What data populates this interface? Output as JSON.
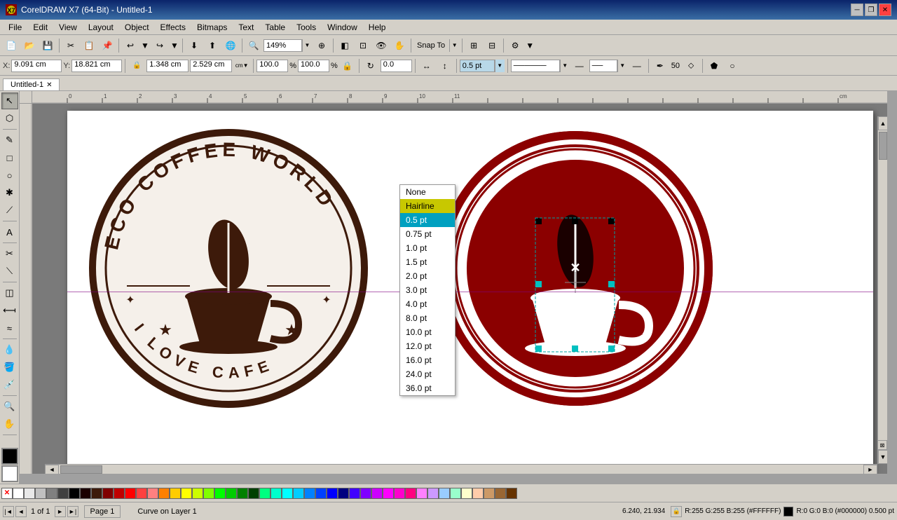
{
  "titlebar": {
    "title": "CorelDRAW X7 (64-Bit) - Untitled-1",
    "minimize": "─",
    "maximize": "□",
    "close": "✕",
    "restore": "❐"
  },
  "menubar": {
    "items": [
      "File",
      "Edit",
      "View",
      "Layout",
      "Object",
      "Effects",
      "Bitmaps",
      "Text",
      "Table",
      "Tools",
      "Window",
      "Help"
    ]
  },
  "toolbar": {
    "zoom_level": "149%",
    "snap_to": "Snap To"
  },
  "properties": {
    "x_label": "X:",
    "x_value": "9.091 cm",
    "y_label": "Y:",
    "y_value": "18.821 cm",
    "w_label": "",
    "w_value": "1.348 cm",
    "h_value": "2.529 cm",
    "scale1": "100.0",
    "scale2": "100.0",
    "angle": "0.0",
    "outline_size": "0.5 pt",
    "line_style": "──────",
    "arrow_end": "──",
    "percent_label": "50"
  },
  "document_tab": {
    "name": "Untitled-1",
    "close_btn": "✕"
  },
  "dropdown": {
    "items": [
      {
        "label": "None",
        "state": "normal"
      },
      {
        "label": "Hairline",
        "state": "highlighted"
      },
      {
        "label": "0.5 pt",
        "state": "selected"
      },
      {
        "label": "0.75 pt",
        "state": "normal"
      },
      {
        "label": "1.0 pt",
        "state": "normal"
      },
      {
        "label": "1.5 pt",
        "state": "normal"
      },
      {
        "label": "2.0 pt",
        "state": "normal"
      },
      {
        "label": "3.0 pt",
        "state": "normal"
      },
      {
        "label": "4.0 pt",
        "state": "normal"
      },
      {
        "label": "8.0 pt",
        "state": "normal"
      },
      {
        "label": "10.0 pt",
        "state": "normal"
      },
      {
        "label": "12.0 pt",
        "state": "normal"
      },
      {
        "label": "16.0 pt",
        "state": "normal"
      },
      {
        "label": "24.0 pt",
        "state": "normal"
      },
      {
        "label": "36.0 pt",
        "state": "normal"
      }
    ]
  },
  "statusbar": {
    "coords": "6.240, 21.934",
    "page_info": "1 of 1",
    "page_name": "Page 1",
    "status_text": "Curve on Layer 1",
    "color_info": "R:255 G:255 B:255 (#FFFFFF)",
    "outline_info": "R:0 G:0 B:0 (#000000) 0.500 pt"
  },
  "palette": {
    "colors": [
      "#FFFFFF",
      "#000000",
      "#808080",
      "#C0C0C0",
      "#800000",
      "#FF0000",
      "#FF8000",
      "#FFFF00",
      "#808000",
      "#00FF00",
      "#008000",
      "#00FFFF",
      "#008080",
      "#0000FF",
      "#000080",
      "#FF00FF",
      "#800080",
      "#FF8080",
      "#FF80FF",
      "#8080FF",
      "#80FFFF",
      "#80FF80",
      "#FFFF80",
      "#FF8040",
      "#804000",
      "#004080",
      "#0080FF",
      "#00FF80",
      "#FF0080",
      "#8000FF",
      "#FF4040",
      "#40FF40",
      "#4040FF",
      "#FFCC00",
      "#CC6600",
      "#996633",
      "#663300",
      "#CCCC00",
      "#CC9900",
      "#999900",
      "#669900",
      "#336600",
      "#003300",
      "#006633",
      "#009966",
      "#00CC99",
      "#00FFCC",
      "#33FFFF",
      "#3399FF",
      "#3366FF",
      "#3333FF",
      "#6633FF",
      "#9933FF",
      "#CC33FF",
      "#FF33CC",
      "#FF3399",
      "#FF3366",
      "#FF3333",
      "#FF6633",
      "#FF9933",
      "#FFCC33",
      "#FFFF33",
      "#CCFF33",
      "#99FF33"
    ]
  },
  "left_toolbar": {
    "tools": [
      "↖",
      "⬡",
      "✎",
      "□",
      "○",
      "✱",
      "⟊",
      "A",
      "✂",
      "🔗",
      "💧",
      "☁",
      "⌂",
      "🔍",
      "◫",
      "⬢",
      "↕",
      "🎨",
      "⬛",
      "▲",
      "🖊",
      "≡"
    ]
  }
}
